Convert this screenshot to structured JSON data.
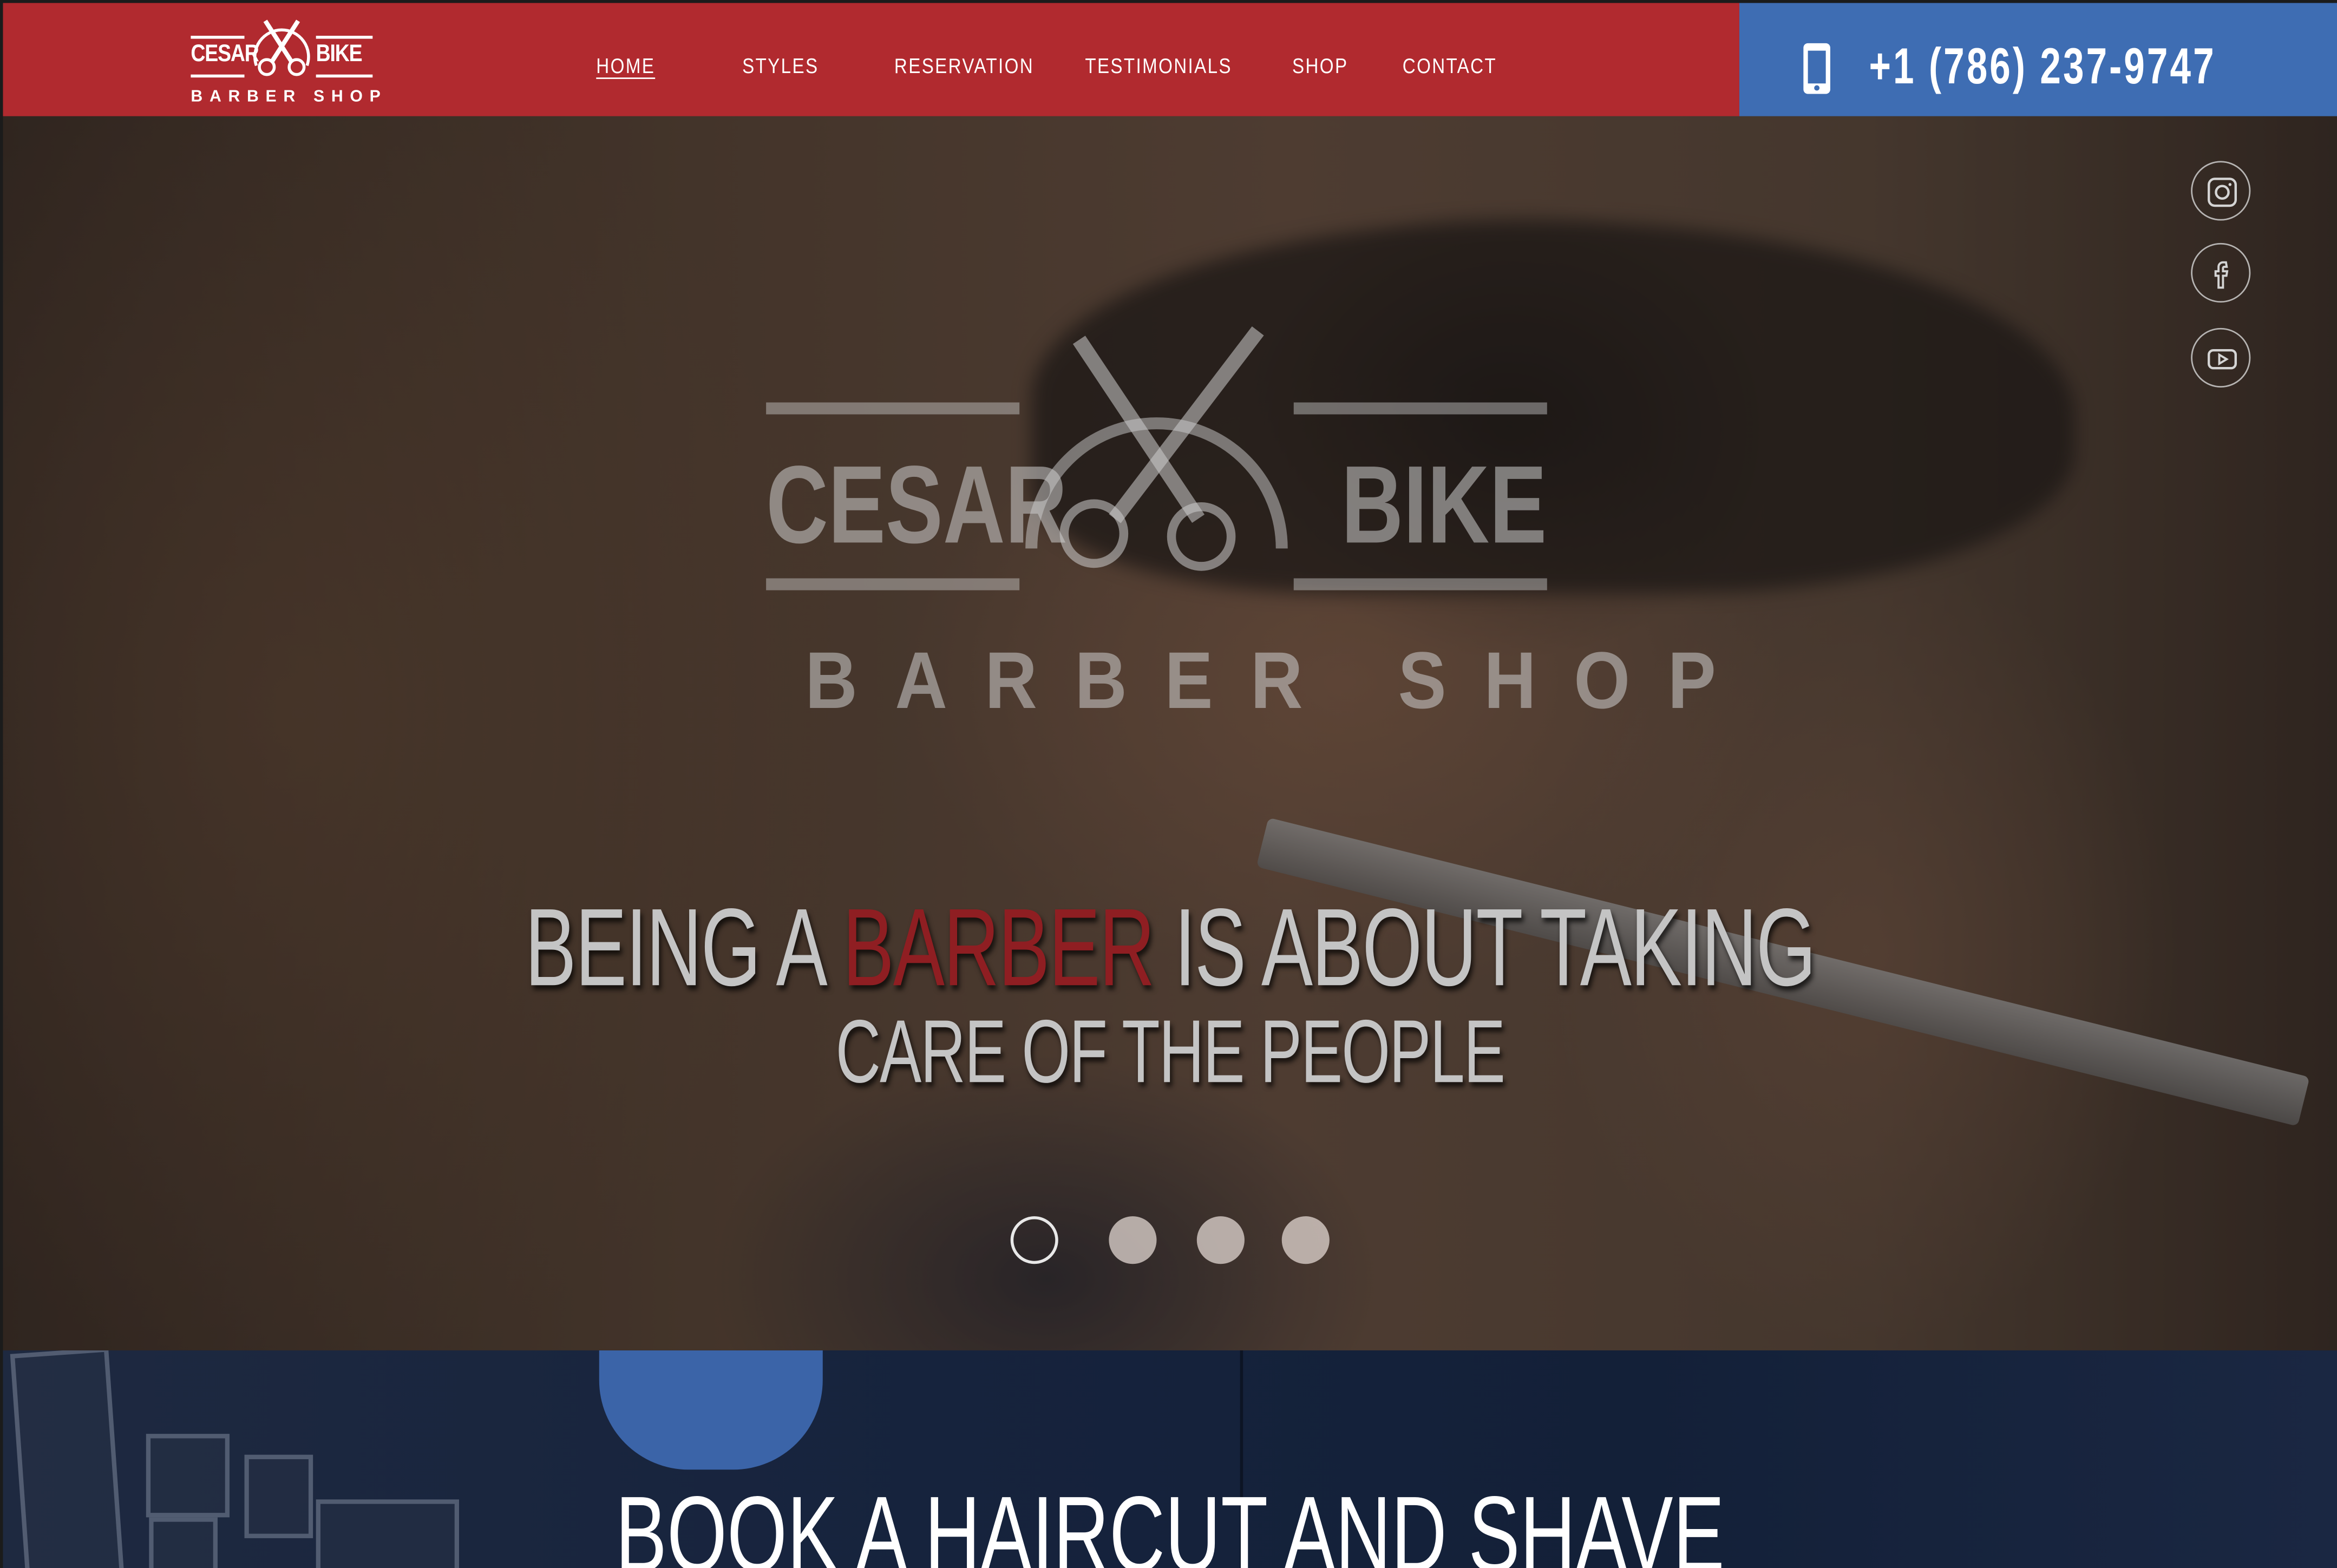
{
  "header": {
    "logo": {
      "word_left": "CESAR",
      "word_right": "BIKE",
      "subtitle": "BARBER SHOP"
    },
    "nav": [
      {
        "label": "HOME",
        "active": true
      },
      {
        "label": "STYLES",
        "active": false
      },
      {
        "label": "RESERVATION",
        "active": false
      },
      {
        "label": "TESTIMONIALS",
        "active": false
      },
      {
        "label": "SHOP",
        "active": false
      },
      {
        "label": "CONTACT",
        "active": false
      }
    ],
    "phone": {
      "icon": "smartphone-icon",
      "number": "+1 (786) 237-9747"
    }
  },
  "hero": {
    "watermark": {
      "word_left": "CESAR",
      "word_right": "BIKE",
      "subtitle": "BARBER SHOP"
    },
    "headline": {
      "part1": "BEING A ",
      "accent": "BARBER",
      "part2": " IS ABOUT TAKING",
      "line2": "CARE OF THE PEOPLE"
    },
    "social": [
      "instagram-icon",
      "facebook-icon",
      "youtube-icon"
    ],
    "slider": {
      "total": 4,
      "active_index": 0
    }
  },
  "booking": {
    "title": "BOOK A HAIRCUT AND SHAVE"
  },
  "colors": {
    "header_red": "#b12a2f",
    "phone_blue": "#3e6db3",
    "accent_red": "#8f1e22",
    "booking_navy": "#16233d"
  }
}
